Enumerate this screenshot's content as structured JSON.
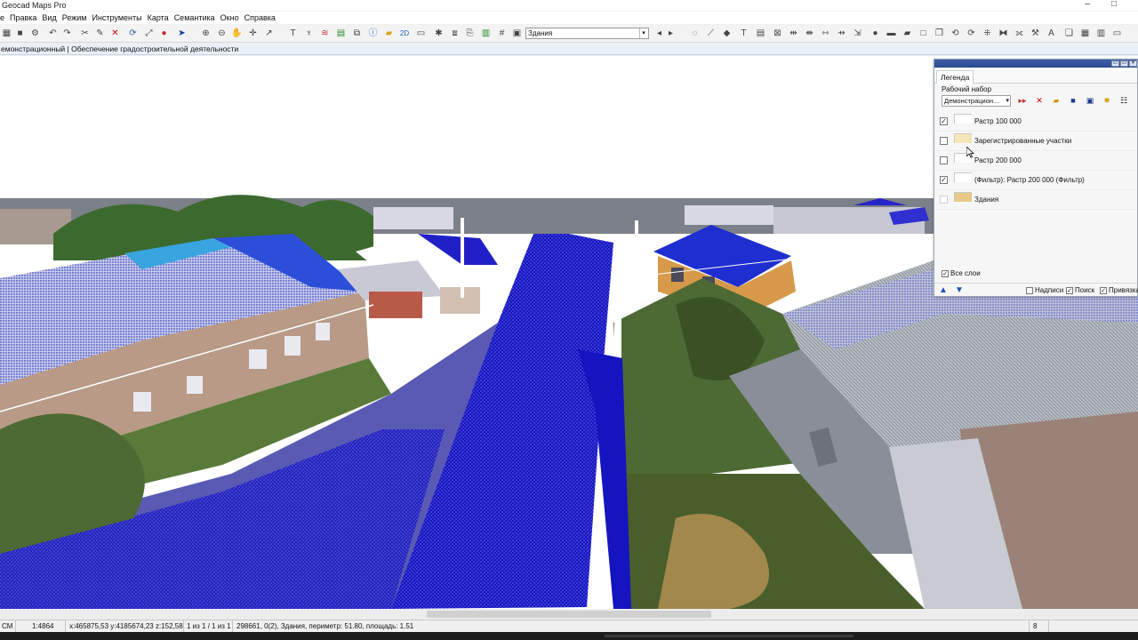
{
  "window": {
    "title": "Geocad Maps Pro",
    "minimize": "–",
    "maximize": "□"
  },
  "menu": {
    "items": [
      "е",
      "Правка",
      "Вид",
      "Режим",
      "Инструменты",
      "Карта",
      "Семантика",
      "Окно",
      "Справка"
    ]
  },
  "toolbar": {
    "mode_2d": "2D",
    "layer_select_value": "Здания",
    "icons": [
      "grid-icon",
      "save-icon",
      "settings-icon",
      "undo-icon",
      "redo-icon",
      "scissors-icon",
      "wrench-icon",
      "close-red-icon",
      "refresh-icon",
      "crop-icon",
      "bug-icon",
      "pointer-icon",
      "zoom-in-icon",
      "zoom-out-icon",
      "hand-icon",
      "crosshair-icon",
      "arrow-tool-icon",
      "text-t-icon",
      "binoculars-icon",
      "layers-icon",
      "palette-icon",
      "database-icon",
      "info-icon",
      "folder-icon",
      "table-icon",
      "calculator-icon",
      "hash-icon",
      "circle-icon"
    ]
  },
  "document": {
    "title": "емонстрационный | Обеспечение градостроительной деятельности"
  },
  "legend": {
    "tab_label": "Легенда",
    "workset_label": "Рабочий набор",
    "workset_value": "Демонстрацион...",
    "layers": [
      {
        "label": "Растр 100 000",
        "checked": true,
        "swatch": "#ffffff"
      },
      {
        "label": "Зарегистрированные участки",
        "checked": false,
        "swatch": "#f4e6b8"
      },
      {
        "label": "Растр 200 000",
        "checked": false,
        "swatch": "#ffffff"
      },
      {
        "label": "(Фильтр): Растр 200 000 (Фильтр)",
        "checked": true,
        "swatch": "#ffffff"
      },
      {
        "label": "Здания",
        "checked": false,
        "swatch": "#e9c98a"
      }
    ],
    "all_layers_label": "Все слои",
    "all_layers_checked": true,
    "options": [
      {
        "label": "Надписи",
        "checked": false
      },
      {
        "label": "Поиск",
        "checked": true
      },
      {
        "label": "Привязка",
        "checked": true
      }
    ],
    "check_mark": "✓"
  },
  "status": {
    "units": "СМ",
    "scale": "1:4864",
    "coords": "x:465875,53 y:4185674,23 z:152,58",
    "selection": "1 из 1 / 1 из 1",
    "object_info": "298661, 0(2), Здания, периметр: 51.80, площадь: 1.51",
    "right_value": "8"
  },
  "colors": {
    "point_cloud_blue": "#1010c8",
    "accent_caption": "#2b4a93"
  }
}
